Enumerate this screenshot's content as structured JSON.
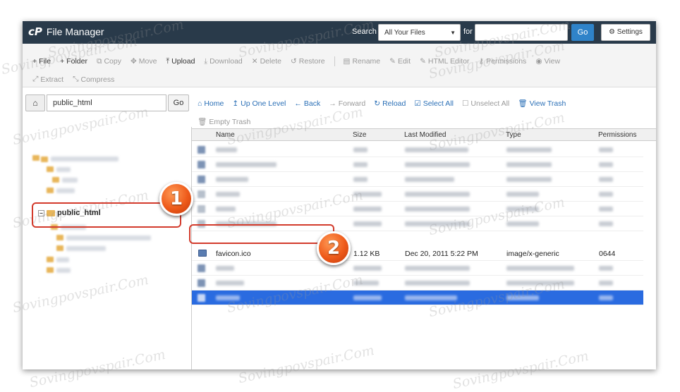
{
  "header": {
    "logo": "cP",
    "title": "File Manager",
    "search_label": "Search",
    "search_scope": "All Your Files",
    "for_label": "for",
    "search_value": "",
    "go_label": "Go",
    "settings_label": "Settings"
  },
  "toolbar": {
    "row1": [
      {
        "icon": "plus-icon",
        "glyph": "+",
        "label": "File",
        "enabled": true
      },
      {
        "icon": "plus-icon",
        "glyph": "+",
        "label": "Folder",
        "enabled": true
      },
      {
        "icon": "copy-icon",
        "glyph": "⧉",
        "label": "Copy",
        "enabled": false
      },
      {
        "icon": "move-icon",
        "glyph": "✥",
        "label": "Move",
        "enabled": false
      },
      {
        "icon": "upload-icon",
        "glyph": "⤒",
        "label": "Upload",
        "enabled": true
      },
      {
        "icon": "download-icon",
        "glyph": "⤓",
        "label": "Download",
        "enabled": false
      },
      {
        "icon": "delete-icon",
        "glyph": "✕",
        "label": "Delete",
        "enabled": false
      },
      {
        "icon": "restore-icon",
        "glyph": "↺",
        "label": "Restore",
        "enabled": false
      },
      {
        "icon": "rename-icon",
        "glyph": "▤",
        "label": "Rename",
        "enabled": false
      },
      {
        "icon": "edit-icon",
        "glyph": "✎",
        "label": "Edit",
        "enabled": false
      },
      {
        "icon": "html-editor-icon",
        "glyph": "✎",
        "label": "HTML Editor",
        "enabled": false
      },
      {
        "icon": "permissions-icon",
        "glyph": "⚷",
        "label": "Permissions",
        "enabled": false
      },
      {
        "icon": "view-icon",
        "glyph": "◉",
        "label": "View",
        "enabled": false
      }
    ],
    "row2": [
      {
        "icon": "extract-icon",
        "glyph": "⤢",
        "label": "Extract",
        "enabled": false
      },
      {
        "icon": "compress-icon",
        "glyph": "⤡",
        "label": "Compress",
        "enabled": false
      }
    ]
  },
  "path": {
    "value": "public_html",
    "go_label": "Go"
  },
  "nav": [
    {
      "icon": "home-icon",
      "glyph": "⌂",
      "label": "Home",
      "enabled": true
    },
    {
      "icon": "up-level-icon",
      "glyph": "↥",
      "label": "Up One Level",
      "enabled": true
    },
    {
      "icon": "back-icon",
      "glyph": "←",
      "label": "Back",
      "enabled": true
    },
    {
      "icon": "forward-icon",
      "glyph": "→",
      "label": "Forward",
      "enabled": false
    },
    {
      "icon": "reload-icon",
      "glyph": "↻",
      "label": "Reload",
      "enabled": true
    },
    {
      "icon": "select-all-icon",
      "glyph": "☑",
      "label": "Select All",
      "enabled": true
    },
    {
      "icon": "unselect-all-icon",
      "glyph": "☐",
      "label": "Unselect All",
      "enabled": false
    },
    {
      "icon": "trash-icon",
      "glyph": "🗑",
      "label": "View Trash",
      "enabled": true
    }
  ],
  "empty_trash": {
    "glyph": "🗑",
    "label": "Empty Trash"
  },
  "tree": {
    "selected_label": "public_html"
  },
  "table": {
    "columns": [
      "Name",
      "Size",
      "Last Modified",
      "Type",
      "Permissions"
    ],
    "focus_row": {
      "name": "favicon.ico",
      "size": "1.12 KB",
      "modified": "Dec 20, 2011 5:22 PM",
      "type": "image/x-generic",
      "perms": "0644"
    }
  },
  "watermark": "Sovingpovspair.Com",
  "callouts": {
    "one": "1",
    "two": "2"
  },
  "colors": {
    "topbar": "#293a4a",
    "accent": "#2f83c9",
    "selection": "#2a6be0",
    "badge": "#ee5a1a",
    "callout_ring": "#d33b2c"
  }
}
